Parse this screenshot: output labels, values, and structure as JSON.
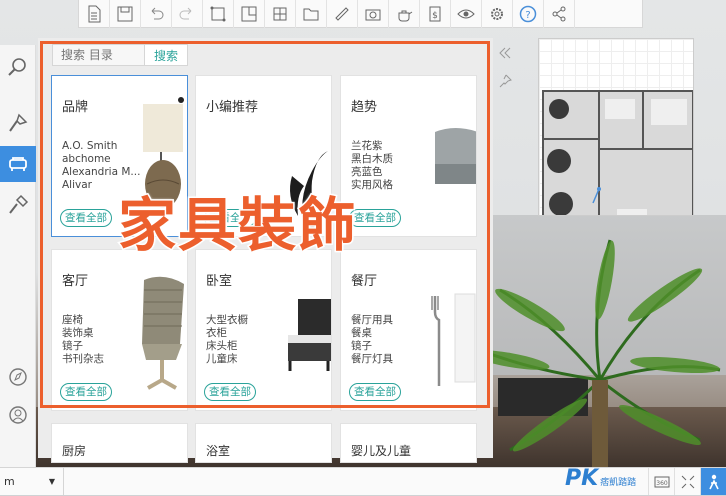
{
  "search": {
    "placeholder": "搜索 目录",
    "button": "搜索"
  },
  "overlay_caption": "家具裝飾",
  "cards": [
    {
      "title": "品牌",
      "items": [
        "A.O. Smith",
        "abchome",
        "Alexandria M...",
        "Alivar"
      ],
      "link": "查看全部"
    },
    {
      "title": "小编推荐",
      "items": [],
      "link": "查看全部"
    },
    {
      "title": "趋势",
      "items": [
        "兰花紫",
        "黑白木质",
        "亮蓝色",
        "实用风格"
      ],
      "link": "查看全部"
    },
    {
      "title": "客厅",
      "items": [
        "座椅",
        "装饰桌",
        "镜子",
        "书刊杂志"
      ],
      "link": "查看全部"
    },
    {
      "title": "卧室",
      "items": [
        "大型衣橱",
        "衣柜",
        "床头柜",
        "儿童床"
      ],
      "link": "查看全部"
    },
    {
      "title": "餐厅",
      "items": [
        "餐厅用具",
        "餐桌",
        "镜子",
        "餐厅灯具"
      ],
      "link": "查看全部"
    }
  ],
  "bottom_cards": [
    "厨房",
    "浴室",
    "婴儿及儿童"
  ],
  "unit": "m",
  "watermark": {
    "main": "PK",
    "sub": "痞凱踏踏"
  },
  "toolbar_icons": [
    "document-icon",
    "save-icon",
    "undo-icon",
    "redo-icon",
    "wall-icon",
    "room-icon",
    "window-icon",
    "folder-icon",
    "ruler-icon",
    "camera-icon",
    "teapot-icon",
    "price-icon",
    "eye-icon",
    "settings-icon",
    "help-icon",
    "share-icon"
  ],
  "colors": {
    "accent": "#ec5f2d",
    "teal": "#2aa39a",
    "blue": "#3d8ee0"
  }
}
